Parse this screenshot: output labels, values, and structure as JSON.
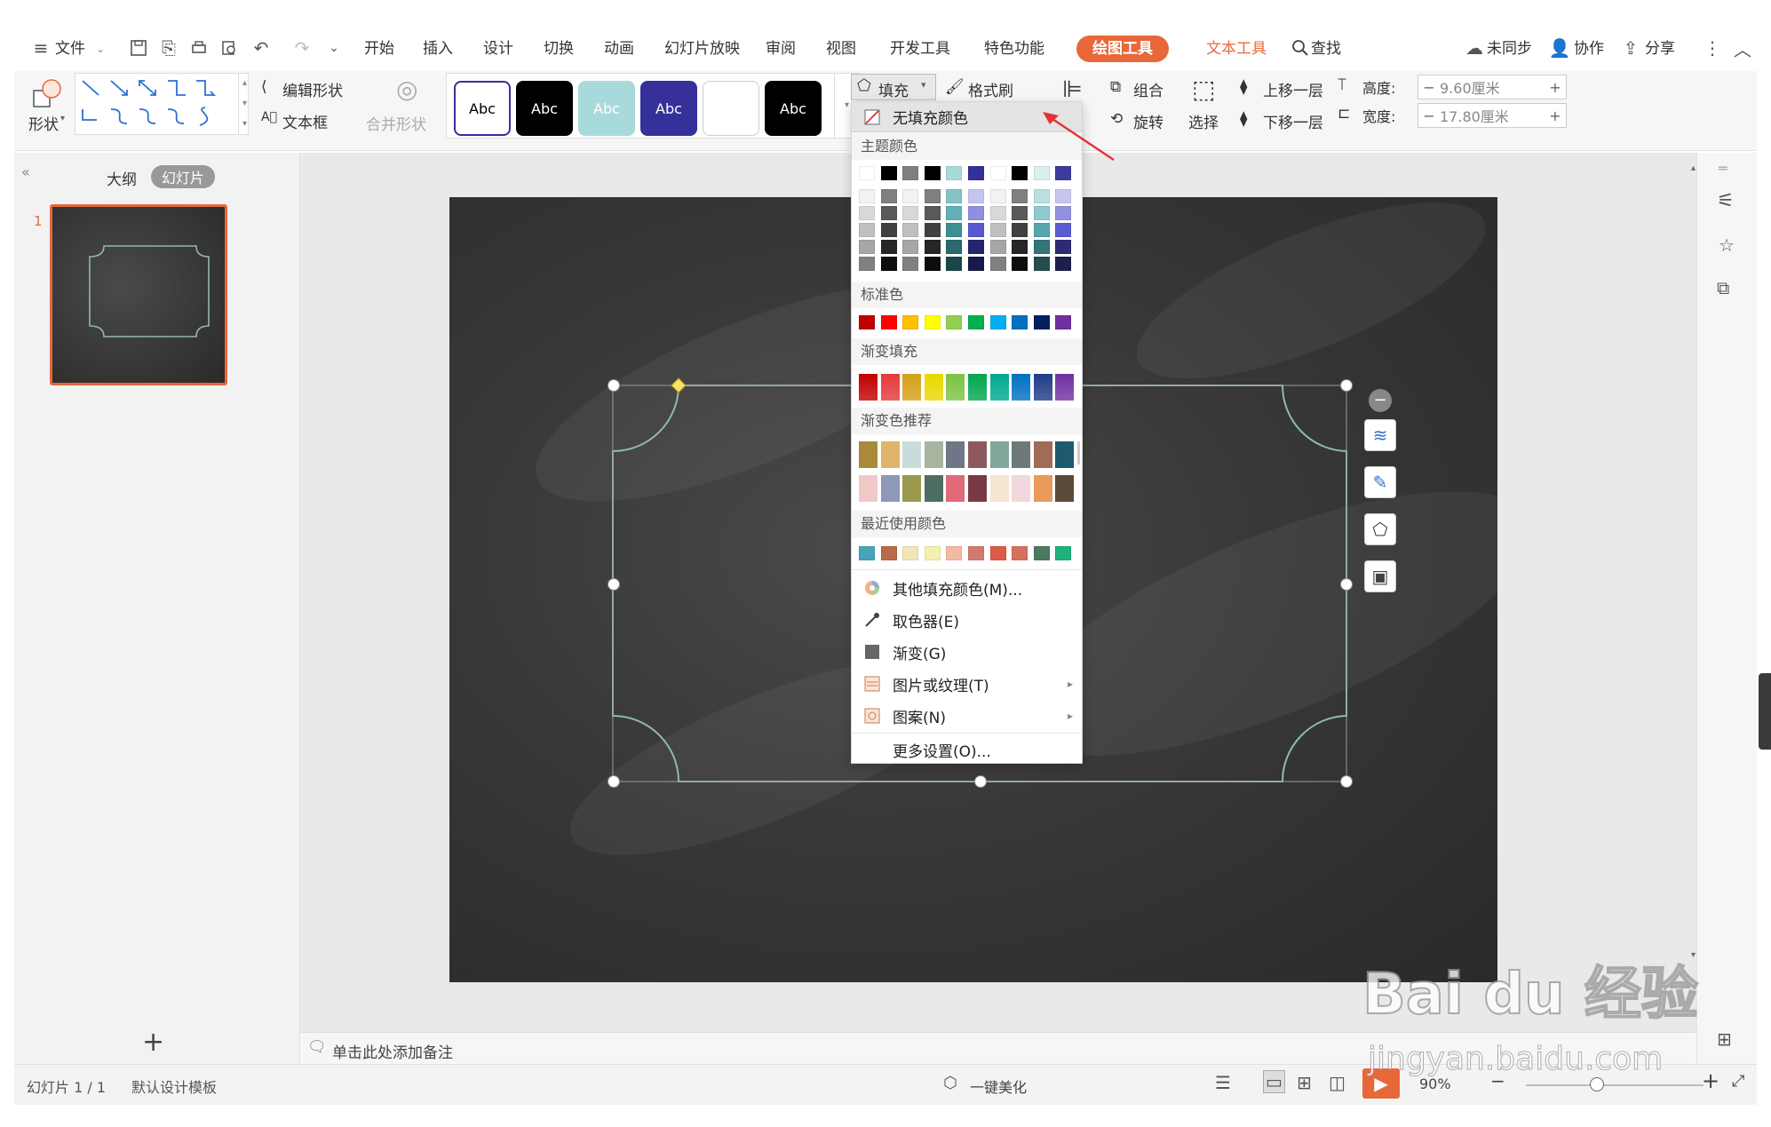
{
  "menubar": {
    "file_label": "文件",
    "tabs": [
      "开始",
      "插入",
      "设计",
      "切换",
      "动画",
      "幻灯片放映",
      "审阅",
      "视图",
      "开发工具",
      "特色功能"
    ],
    "context_tab_drawing": "绘图工具",
    "context_tab_text": "文本工具",
    "search_label": "查找",
    "sync_label": "未同步",
    "collab_label": "协作",
    "share_label": "分享"
  },
  "ribbon": {
    "shape_label": "形状",
    "edit_shape_label": "编辑形状",
    "textbox_label": "文本框",
    "merge_shape_label": "合并形状",
    "style_samples": [
      "Abc",
      "Abc",
      "Abc",
      "Abc",
      "",
      "Abc"
    ],
    "fill_label": "填充",
    "format_brush_label": "格式刷",
    "group_label": "组合",
    "rotate_label": "旋转",
    "select_label": "选择",
    "bring_forward_label": "上移一层",
    "send_backward_label": "下移一层",
    "height_label": "高度:",
    "height_value": "9.60厘米",
    "width_label": "宽度:",
    "width_value": "17.80厘米"
  },
  "left_panel": {
    "tab_outline": "大纲",
    "tab_slides": "幻灯片",
    "slide_number": "1"
  },
  "fill_dropdown": {
    "no_fill": "无填充颜色",
    "theme_colors_header": "主题颜色",
    "standard_colors_header": "标准色",
    "gradient_fill_header": "渐变填充",
    "gradient_recommend_header": "渐变色推荐",
    "recent_colors_header": "最近使用颜色",
    "theme_top_row": [
      "#ffffff",
      "#000000",
      "#7f7f7f",
      "#000000",
      "#a9dadb",
      "#35309a",
      "#ffffff",
      "#000000",
      "#dbeef0",
      "#3c3c9c"
    ],
    "theme_shade_rows": [
      [
        "#f2f2f2",
        "#7f7f7f",
        "#f2f2f2",
        "#7f7f7f",
        "#83c3c6",
        "#c4c4ee",
        "#f2f2f2",
        "#7f7f7f",
        "#b8e0e2",
        "#c6c6ef"
      ],
      [
        "#d9d9d9",
        "#595959",
        "#d9d9d9",
        "#595959",
        "#5fb1b5",
        "#8f8ee0",
        "#d9d9d9",
        "#595959",
        "#8dcbcf",
        "#9191e0"
      ],
      [
        "#bfbfbf",
        "#404040",
        "#bfbfbf",
        "#404040",
        "#3c8f93",
        "#5a58cf",
        "#bfbfbf",
        "#404040",
        "#54a7ad",
        "#5b5bd1"
      ],
      [
        "#a6a6a6",
        "#262626",
        "#a6a6a6",
        "#262626",
        "#2a6a6d",
        "#27246f",
        "#a6a6a6",
        "#262626",
        "#357478",
        "#2c2c76"
      ],
      [
        "#808080",
        "#0d0d0d",
        "#808080",
        "#0d0d0d",
        "#1c4749",
        "#1a184a",
        "#808080",
        "#0d0d0d",
        "#234e51",
        "#1e1e4f"
      ]
    ],
    "standard_colors": [
      "#c00000",
      "#ff0000",
      "#ffc000",
      "#ffff00",
      "#92d050",
      "#00b050",
      "#00b0f0",
      "#0070c0",
      "#002060",
      "#7030a0"
    ],
    "gradient_fill": [
      "#c00000",
      "#e5383b",
      "#d4a017",
      "#e9d700",
      "#7cc242",
      "#00a650",
      "#00a88f",
      "#0070c0",
      "#1f3c88",
      "#7030a0"
    ],
    "gradient_recommend_row1": [
      "#a88a3a",
      "#e0b46a",
      "#c8dcdc",
      "#a7b49f",
      "#6f7686",
      "#8c5a5e",
      "#7fa89a",
      "#6e7a7a",
      "#a16b57",
      "#1e5a6e"
    ],
    "gradient_recommend_row2": [
      "#f0c8c8",
      "#8e98b8",
      "#9a9a4e",
      "#4f6e62",
      "#e06a7a",
      "#7a3a44",
      "#f5e6d2",
      "#f0d8dc",
      "#e89a5a",
      "#5a4a3a"
    ],
    "recent_colors": [
      "#4aa3b8",
      "#b86a4a",
      "#f3e6b4",
      "#f5f0b0",
      "#f4b8a4",
      "#d27a6e",
      "#e05a4a",
      "#d8705e",
      "#4a7a60",
      "#20b07a"
    ],
    "more_fill_colors": "其他填充颜色(M)...",
    "eyedropper": "取色器(E)",
    "gradient": "渐变(G)",
    "picture_texture": "图片或纹理(T)",
    "pattern": "图案(N)",
    "more_settings": "更多设置(O)..."
  },
  "notes_placeholder": "单击此处添加备注",
  "statusbar": {
    "slide_info": "幻灯片 1 / 1",
    "template": "默认设计模板",
    "beautify": "一键美化",
    "zoom": "90%"
  },
  "watermark": {
    "logo_text": "Bai du 经验",
    "url_text": "jingyan.baidu.com"
  },
  "colors": {
    "drawing_tab_bg": "#e8683a",
    "text_tab_color": "#e8683a",
    "selection_accent": "#e8683a"
  }
}
